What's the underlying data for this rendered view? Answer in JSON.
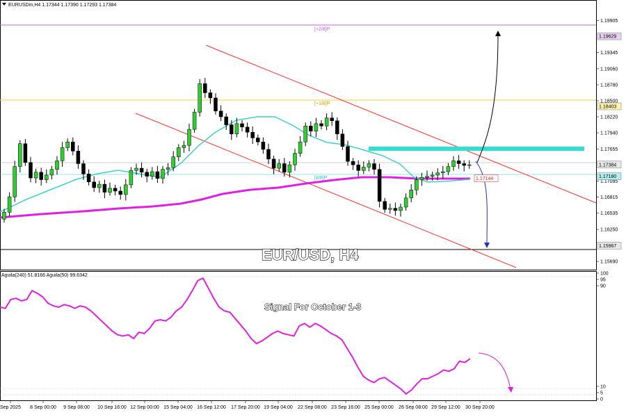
{
  "header": {
    "symbol_line": "EURUSDm,H4  1.17344 1.17390 1.17293 1.17384",
    "dropdown_icon": "triangle-down-icon"
  },
  "title": "EUR/USD, H4",
  "signal_text": "Signal For October 1-3",
  "oscillator": {
    "label": "Aguila(240) 51.8166  Aguila(50) 99.6342",
    "ticks": [
      "100",
      "95",
      "90",
      "10",
      "5",
      "0"
    ],
    "ylim": [
      0,
      100
    ],
    "color": "#e020e0"
  },
  "price_axis": {
    "ticks": [
      "1.19905",
      "1.19345",
      "1.19060",
      "1.18780",
      "1.18500",
      "1.18220",
      "1.17940",
      "1.17655",
      "1.17095",
      "1.16815",
      "1.16535",
      "1.16250",
      "1.15690"
    ],
    "ylim": [
      1.1557,
      1.2019
    ]
  },
  "boxes": [
    {
      "text": "1.19629",
      "bg": "#e8d0f0",
      "fg": "#000000"
    },
    {
      "text": "1.18403",
      "bg": "#fff3b0",
      "fg": "#000000"
    },
    {
      "text": "1.17384",
      "bg": "#e8e8e8",
      "fg": "#000000"
    },
    {
      "text": "1.17180",
      "bg": "#b0f0f0",
      "fg": "#000000"
    },
    {
      "text": "1.17144",
      "bg": "#ffffff",
      "fg": "#e02020"
    },
    {
      "text": "1.15967",
      "bg": "#e8e8e8",
      "fg": "#000000"
    }
  ],
  "fib_labels": {
    "upper": "[+2/8]P",
    "middle": "[+1/8]P",
    "lower": "[8/8]P"
  },
  "time_axis": [
    "Sep 2025",
    "8 Sep 00:00",
    "9 Sep 08:00",
    "10 Sep 16:00",
    "12 Sep 00:00",
    "15 Sep 04:00",
    "16 Sep 12:00",
    "17 Sep 20:00",
    "19 Sep 04:00",
    "22 Sep 08:00",
    "23 Sep 16:00",
    "25 Sep 00:00",
    "26 Sep 08:00",
    "29 Sep 12:00",
    "30 Sep 20:00"
  ],
  "colors": {
    "bull": "#33cc33",
    "bear": "#000000",
    "sma21": "#40d0c8",
    "sma200": "#e020e0",
    "channel": "#ff3030",
    "resistance": "#30e0d0",
    "fib_upper": "#c060e0",
    "fib_middle": "#f0d040"
  },
  "chart_data": {
    "type": "candlestick",
    "instrument": "EURUSDm",
    "timeframe": "H4",
    "ohlc_last": {
      "open": 1.17344,
      "high": 1.1739,
      "low": 1.17293,
      "close": 1.17384
    },
    "closes": [
      1.1655,
      1.1682,
      1.1735,
      1.1775,
      1.1742,
      1.1715,
      1.1725,
      1.1712,
      1.172,
      1.173,
      1.1745,
      1.1768,
      1.1778,
      1.1762,
      1.174,
      1.1722,
      1.1708,
      1.1698,
      1.1704,
      1.169,
      1.1697,
      1.1692,
      1.1686,
      1.1703,
      1.1728,
      1.1732,
      1.1725,
      1.1718,
      1.1726,
      1.1714,
      1.173,
      1.1733,
      1.1752,
      1.1768,
      1.1772,
      1.18,
      1.183,
      1.188,
      1.1864,
      1.1855,
      1.1832,
      1.1822,
      1.1808,
      1.1792,
      1.181,
      1.1804,
      1.1795,
      1.1785,
      1.1778,
      1.1765,
      1.1748,
      1.1732,
      1.174,
      1.1725,
      1.1738,
      1.1758,
      1.1778,
      1.1806,
      1.1797,
      1.181,
      1.1806,
      1.182,
      1.1815,
      1.1792,
      1.177,
      1.1744,
      1.1738,
      1.1728,
      1.1734,
      1.174,
      1.173,
      1.1674,
      1.166,
      1.1662,
      1.1658,
      1.1664,
      1.168,
      1.1694,
      1.1712,
      1.1716,
      1.1718,
      1.172,
      1.1724,
      1.1726,
      1.1735,
      1.1745,
      1.174,
      1.1737,
      1.1738
    ],
    "moving_averages": [
      {
        "name": "SMA21",
        "color": "#40d0c8"
      },
      {
        "name": "SMA200",
        "color": "#e020e0"
      }
    ],
    "levels": [
      {
        "price": 1.19629,
        "label": "[+2/8]P"
      },
      {
        "price": 1.18403,
        "label": "[+1/8]P"
      },
      {
        "price": 1.1718,
        "label": "[8/8]P"
      },
      {
        "price": 1.17144
      },
      {
        "price": 1.15967
      }
    ],
    "resistance_zone": 1.1763,
    "oscillator_values": [
      73,
      72,
      79,
      80,
      78,
      79,
      86,
      84,
      81,
      76,
      74,
      73,
      75,
      74,
      72,
      74,
      73,
      70,
      66,
      62,
      58,
      54,
      51,
      50,
      51,
      48,
      53,
      52,
      56,
      62,
      63,
      62,
      65,
      70,
      73,
      79,
      86,
      94,
      96,
      88,
      80,
      73,
      70,
      69,
      64,
      59,
      54,
      48,
      44,
      46,
      49,
      52,
      54,
      52,
      51,
      50,
      58,
      60,
      57,
      60,
      58,
      55,
      52,
      50,
      47,
      40,
      33,
      25,
      18,
      15,
      13,
      16,
      17,
      14,
      11,
      8,
      4,
      7,
      12,
      16,
      16,
      18,
      20,
      23,
      22,
      24,
      30,
      29,
      32
    ]
  }
}
